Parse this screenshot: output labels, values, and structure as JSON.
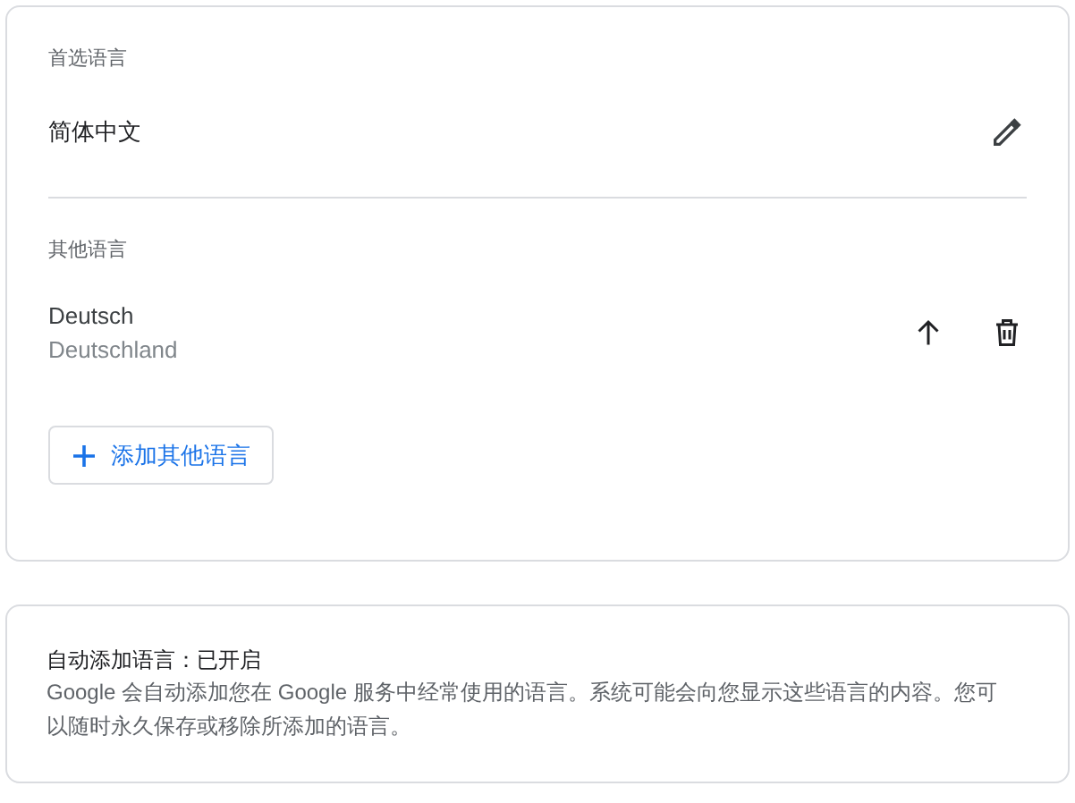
{
  "preferred": {
    "heading": "首选语言",
    "language": "简体中文"
  },
  "other": {
    "heading": "其他语言",
    "languages": [
      {
        "name": "Deutsch",
        "region": "Deutschland"
      }
    ],
    "add_button": "添加其他语言"
  },
  "auto_add": {
    "title": "自动添加语言：已开启",
    "description": "Google 会自动添加您在 Google 服务中经常使用的语言。系统可能会向您显示这些语言的内容。您可以随时永久保存或移除所添加的语言。"
  }
}
